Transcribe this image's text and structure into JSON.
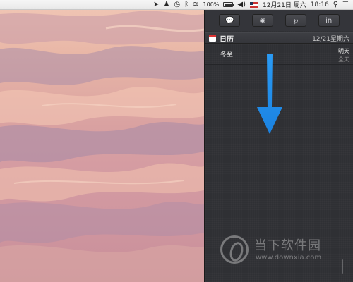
{
  "menubar": {
    "items": [
      {
        "icon": "forward-arrow-icon"
      },
      {
        "icon": "qq-penguin-icon"
      },
      {
        "icon": "time-machine-icon"
      },
      {
        "icon": "bluetooth-icon"
      },
      {
        "icon": "wifi-icon"
      }
    ],
    "battery_percent": "100%",
    "date": "12月21日 周六",
    "time": "18:16"
  },
  "notification_center": {
    "share_buttons": [
      {
        "icon": "messages-icon"
      },
      {
        "icon": "weibo-icon"
      },
      {
        "icon": "tencent-weibo-icon"
      },
      {
        "icon": "linkedin-icon"
      }
    ],
    "calendar": {
      "title": "日历",
      "date": "12/21星期六",
      "events": [
        {
          "title": "冬至",
          "when": "明天",
          "duration": "全天"
        }
      ]
    }
  },
  "annotation": {
    "color": "#1e8ff0",
    "direction": "down"
  },
  "watermark": {
    "title": "当下软件园",
    "url": "www.downxia.com"
  }
}
